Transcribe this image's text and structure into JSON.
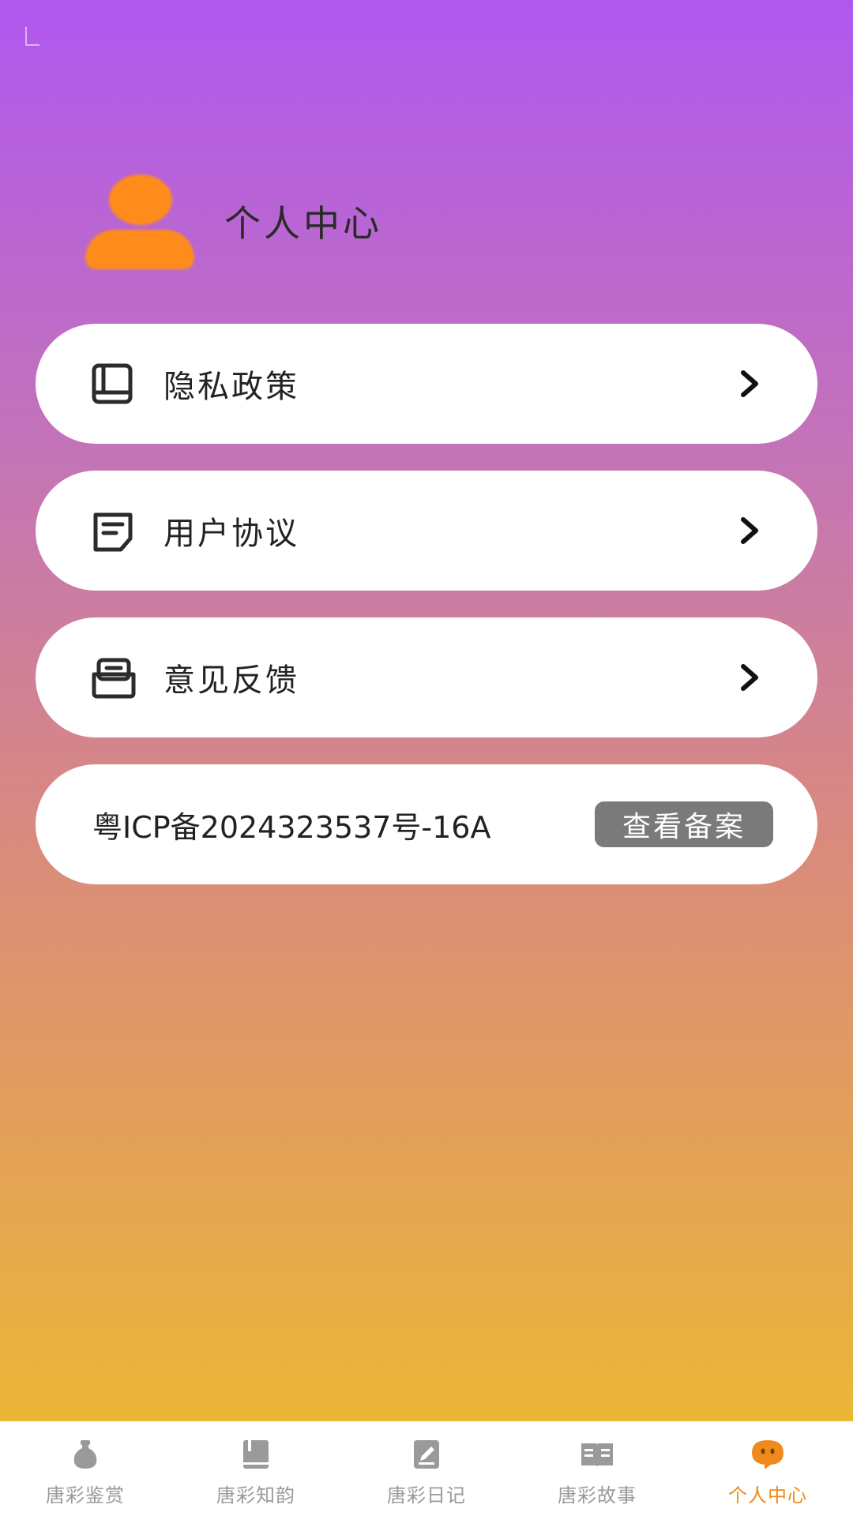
{
  "profile": {
    "title": "个人中心"
  },
  "menu": [
    {
      "label": "隐私政策",
      "icon": "book-icon"
    },
    {
      "label": "用户协议",
      "icon": "document-icon"
    },
    {
      "label": "意见反馈",
      "icon": "inbox-icon"
    }
  ],
  "icp": {
    "text": "粤ICP备2024323537号-16A",
    "button": "查看备案"
  },
  "tabs": [
    {
      "label": "唐彩鉴赏",
      "icon": "vase-icon"
    },
    {
      "label": "唐彩知韵",
      "icon": "book-icon"
    },
    {
      "label": "唐彩日记",
      "icon": "edit-icon"
    },
    {
      "label": "唐彩故事",
      "icon": "open-book-icon"
    },
    {
      "label": "个人中心",
      "icon": "chat-face-icon",
      "active": true
    }
  ],
  "colors": {
    "accent": "#f08a1c",
    "avatar": "#ff8c1a",
    "inactive": "#9a9a9a",
    "icp_button": "#7a7a7a"
  }
}
